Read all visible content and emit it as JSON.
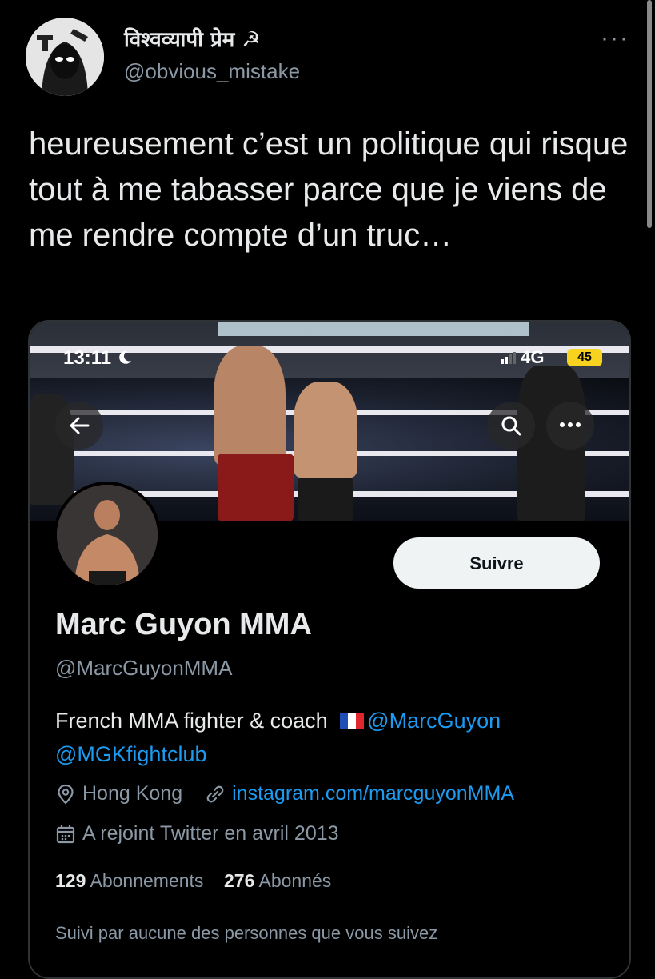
{
  "tweet": {
    "author_name": "विश्वव्यापी प्रेम ☭",
    "author_handle": "@obvious_mistake",
    "more_label": "···",
    "text": "heureusement c’est un politique qui risque tout à me tabasser parce que je viens de me rendre compte d’un truc…"
  },
  "embedded_screenshot": {
    "status_bar": {
      "time": "13:11",
      "network": "4G",
      "battery": "45"
    },
    "profile": {
      "follow_label": "Suivre",
      "name": "Marc Guyon MMA",
      "handle": "@MarcGuyonMMA",
      "bio_text": "French MMA fighter & coach",
      "bio_mention_1": "@MarcGuyon",
      "bio_mention_2": "@MGKfightclub",
      "location": "Hong Kong",
      "website": "instagram.com/marcguyonMMA",
      "joined": "A rejoint Twitter en avril 2013",
      "following_count": "129",
      "following_label": "Abonnements",
      "followers_count": "276",
      "followers_label": "Abonnés",
      "followed_by": "Suivi par aucune des personnes que vous suivez"
    }
  },
  "colors": {
    "accent": "#1d9bf0",
    "battery": "#f7d21e",
    "secondary_text": "#8b98a5"
  },
  "icons": [
    "back-arrow-icon",
    "search-icon",
    "more-icon",
    "location-icon",
    "link-icon",
    "calendar-icon",
    "moon-icon",
    "france-flag-icon"
  ]
}
